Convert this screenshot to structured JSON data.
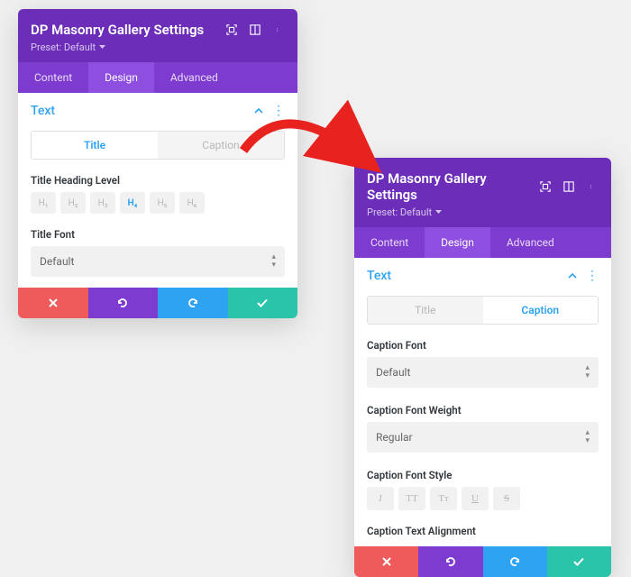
{
  "header": {
    "title": "DP Masonry Gallery Settings",
    "preset": "Preset: Default"
  },
  "tabs": {
    "content": "Content",
    "design": "Design",
    "advanced": "Advanced"
  },
  "section": {
    "text": "Text"
  },
  "subtabs": {
    "title": "Title",
    "caption": "Caption"
  },
  "left": {
    "title_heading_level_label": "Title Heading Level",
    "hlevels": [
      "H₁",
      "H₂",
      "H₃",
      "H₄",
      "H₅",
      "H₆"
    ],
    "title_font_label": "Title Font",
    "title_font_value": "Default"
  },
  "right": {
    "caption_font_label": "Caption Font",
    "caption_font_value": "Default",
    "caption_font_weight_label": "Caption Font Weight",
    "caption_font_weight_value": "Regular",
    "caption_font_style_label": "Caption Font Style",
    "style_btns": [
      "I",
      "TT",
      "Tᴛ",
      "U",
      "S"
    ],
    "caption_text_alignment_label": "Caption Text Alignment"
  }
}
